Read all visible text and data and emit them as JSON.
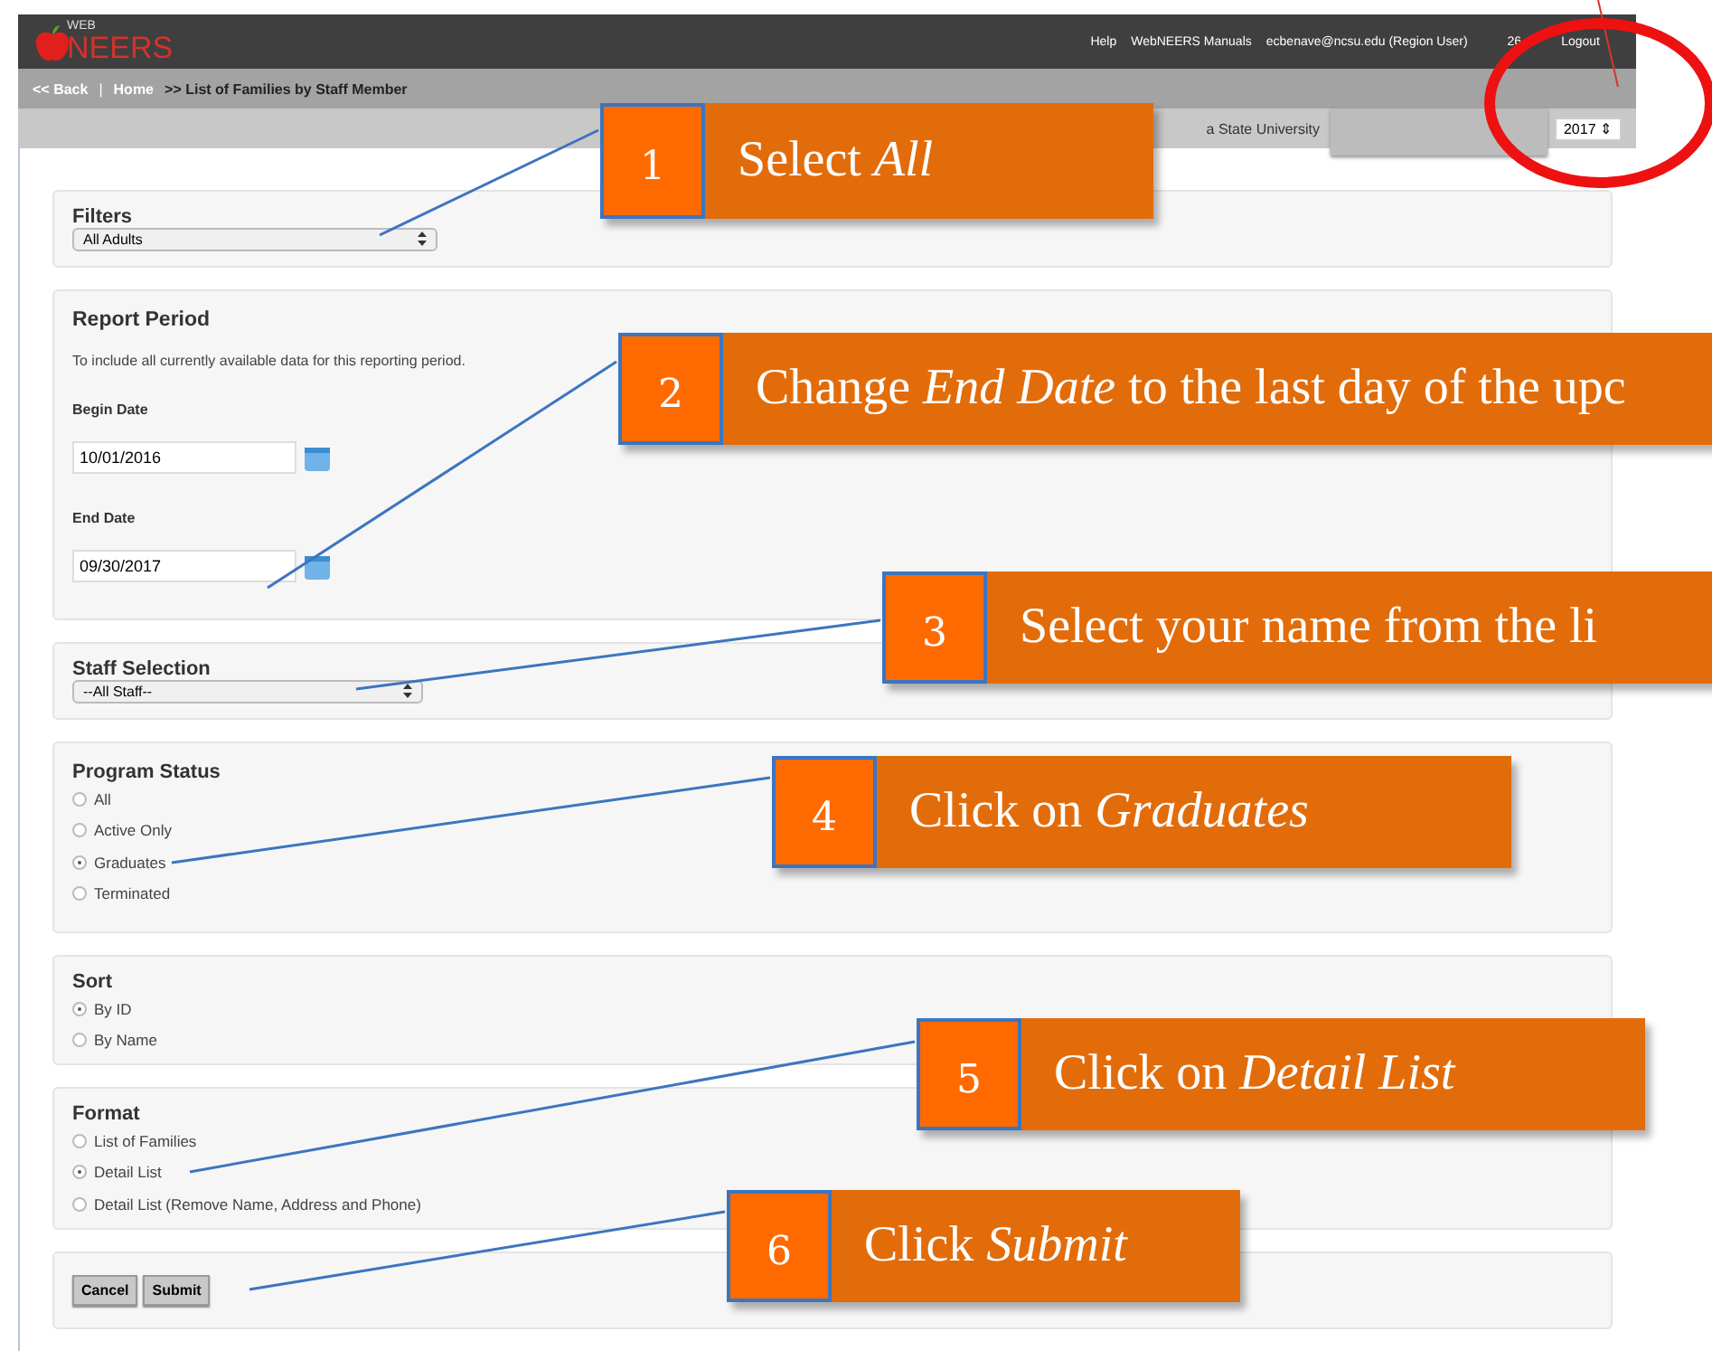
{
  "header": {
    "logo_small": "WEB",
    "logo_large": "NEERS",
    "links": [
      "Help",
      "WebNEERS Manuals",
      "ecbenave@ncsu.edu (Region User)",
      "26",
      "Logout"
    ]
  },
  "breadcrumb": {
    "back": "<< Back",
    "separator": "|",
    "home": "Home",
    "current": ">> List of Families by Staff Member"
  },
  "subbar": {
    "institution": "a State University",
    "year": "2017 ⇕"
  },
  "filters": {
    "title": "Filters",
    "value": "All Adults"
  },
  "report_period": {
    "title": "Report Period",
    "note": "To include all currently available data for this reporting period.",
    "begin_label": "Begin Date",
    "begin_value": "10/01/2016",
    "end_label": "End Date",
    "end_value": "09/30/2017"
  },
  "staff": {
    "title": "Staff Selection",
    "value": "--All Staff--"
  },
  "program_status": {
    "title": "Program Status",
    "options": [
      {
        "label": "All",
        "selected": false
      },
      {
        "label": "Active Only",
        "selected": false
      },
      {
        "label": "Graduates",
        "selected": true
      },
      {
        "label": "Terminated",
        "selected": false
      }
    ]
  },
  "sort": {
    "title": "Sort",
    "options": [
      {
        "label": "By ID",
        "selected": true
      },
      {
        "label": "By Name",
        "selected": false
      }
    ]
  },
  "format": {
    "title": "Format",
    "options": [
      {
        "label": "List of Families",
        "selected": false
      },
      {
        "label": "Detail List",
        "selected": true
      },
      {
        "label": "Detail List (Remove Name, Address and Phone)",
        "selected": false
      }
    ]
  },
  "buttons": [
    "Cancel",
    "Submit"
  ],
  "callouts": [
    {
      "number": "1",
      "text": "Select *All*"
    },
    {
      "number": "2",
      "text": "Change *End Date* to the last day of the upc"
    },
    {
      "number": "3",
      "text": "Select your name from the li"
    },
    {
      "number": "4",
      "text": "Click on *Graduates*"
    },
    {
      "number": "5",
      "text": "Click on *Detail List*"
    },
    {
      "number": "6",
      "text": "Click *Submit*"
    }
  ]
}
